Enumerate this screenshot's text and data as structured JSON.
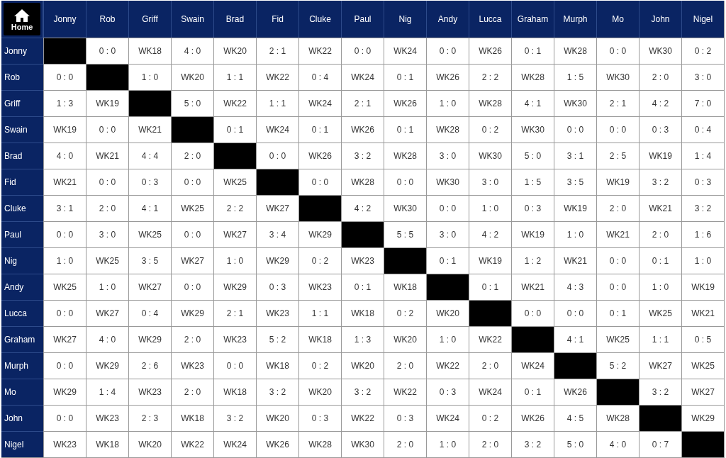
{
  "home_button": {
    "label": "Home"
  },
  "columns": [
    "Jonny",
    "Rob",
    "Griff",
    "Swain",
    "Brad",
    "Fid",
    "Cluke",
    "Paul",
    "Nig",
    "Andy",
    "Lucca",
    "Graham",
    "Murph",
    "Mo",
    "John",
    "Nigel"
  ],
  "rows": [
    {
      "name": "Jonny",
      "cells": [
        null,
        "0 : 0",
        "WK18",
        "4 : 0",
        "WK20",
        "2 : 1",
        "WK22",
        "0 : 0",
        "WK24",
        "0 : 0",
        "WK26",
        "0 : 1",
        "WK28",
        "0 : 0",
        "WK30",
        "0 : 2"
      ]
    },
    {
      "name": "Rob",
      "cells": [
        "0 : 0",
        null,
        "1 : 0",
        "WK20",
        "1 : 1",
        "WK22",
        "0 : 4",
        "WK24",
        "0 : 1",
        "WK26",
        "2 : 2",
        "WK28",
        "1 : 5",
        "WK30",
        "2 : 0",
        "3 : 0"
      ]
    },
    {
      "name": "Griff",
      "cells": [
        "1 : 3",
        "WK19",
        null,
        "5 : 0",
        "WK22",
        "1 : 1",
        "WK24",
        "2 : 1",
        "WK26",
        "1 : 0",
        "WK28",
        "4 : 1",
        "WK30",
        "2 : 1",
        "4 : 2",
        "7 : 0"
      ]
    },
    {
      "name": "Swain",
      "cells": [
        "WK19",
        "0 : 0",
        "WK21",
        null,
        "0 : 1",
        "WK24",
        "0 : 1",
        "WK26",
        "0 : 1",
        "WK28",
        "0 : 2",
        "WK30",
        "0 : 0",
        "0 : 0",
        "0 : 3",
        "0 : 4"
      ]
    },
    {
      "name": "Brad",
      "cells": [
        "4 : 0",
        "WK21",
        "4 : 4",
        "2 : 0",
        null,
        "0 : 0",
        "WK26",
        "3 : 2",
        "WK28",
        "3 : 0",
        "WK30",
        "5 : 0",
        "3 : 1",
        "2 : 5",
        "WK19",
        "1 : 4"
      ]
    },
    {
      "name": "Fid",
      "cells": [
        "WK21",
        "0 : 0",
        "0 : 3",
        "0 : 0",
        "WK25",
        null,
        "0 : 0",
        "WK28",
        "0 : 0",
        "WK30",
        "3 : 0",
        "1 : 5",
        "3 : 5",
        "WK19",
        "3 : 2",
        "0 : 3"
      ]
    },
    {
      "name": "Cluke",
      "cells": [
        "3 : 1",
        "2 : 0",
        "4 : 1",
        "WK25",
        "2 : 2",
        "WK27",
        null,
        "4 : 2",
        "WK30",
        "0 : 0",
        "1 : 0",
        "0 : 3",
        "WK19",
        "2 : 0",
        "WK21",
        "3 : 2"
      ]
    },
    {
      "name": "Paul",
      "cells": [
        "0 : 0",
        "3 : 0",
        "WK25",
        "0 : 0",
        "WK27",
        "3 : 4",
        "WK29",
        null,
        "5 : 5",
        "3 : 0",
        "4 : 2",
        "WK19",
        "1 : 0",
        "WK21",
        "2 : 0",
        "1 : 6"
      ]
    },
    {
      "name": "Nig",
      "cells": [
        "1 : 0",
        "WK25",
        "3 : 5",
        "WK27",
        "1 : 0",
        "WK29",
        "0 : 2",
        "WK23",
        null,
        "0 : 1",
        "WK19",
        "1 : 2",
        "WK21",
        "0 : 0",
        "0 : 1",
        "1 : 0"
      ]
    },
    {
      "name": "Andy",
      "cells": [
        "WK25",
        "1 : 0",
        "WK27",
        "0 : 0",
        "WK29",
        "0 : 3",
        "WK23",
        "0 : 1",
        "WK18",
        null,
        "0 : 1",
        "WK21",
        "4 : 3",
        "0 : 0",
        "1 : 0",
        "WK19"
      ]
    },
    {
      "name": "Lucca",
      "cells": [
        "0 : 0",
        "WK27",
        "0 : 4",
        "WK29",
        "2 : 1",
        "WK23",
        "1 : 1",
        "WK18",
        "0 : 2",
        "WK20",
        null,
        "0 : 0",
        "0 : 0",
        "0 : 1",
        "WK25",
        "WK21"
      ]
    },
    {
      "name": "Graham",
      "cells": [
        "WK27",
        "4 : 0",
        "WK29",
        "2 : 0",
        "WK23",
        "5 : 2",
        "WK18",
        "1 : 3",
        "WK20",
        "1 : 0",
        "WK22",
        null,
        "4 : 1",
        "WK25",
        "1 : 1",
        "0 : 5"
      ]
    },
    {
      "name": "Murph",
      "cells": [
        "0 : 0",
        "WK29",
        "2 : 6",
        "WK23",
        "0 : 0",
        "WK18",
        "0 : 2",
        "WK20",
        "2 : 0",
        "WK22",
        "2 : 0",
        "WK24",
        null,
        "5 : 2",
        "WK27",
        "WK25"
      ]
    },
    {
      "name": "Mo",
      "cells": [
        "WK29",
        "1 : 4",
        "WK23",
        "2 : 0",
        "WK18",
        "3 : 2",
        "WK20",
        "3 : 2",
        "WK22",
        "0 : 3",
        "WK24",
        "0 : 1",
        "WK26",
        null,
        "3 : 2",
        "WK27"
      ]
    },
    {
      "name": "John",
      "cells": [
        "0 : 0",
        "WK23",
        "2 : 3",
        "WK18",
        "3 : 2",
        "WK20",
        "0 : 3",
        "WK22",
        "0 : 3",
        "WK24",
        "0 : 2",
        "WK26",
        "4 : 5",
        "WK28",
        null,
        "WK29"
      ]
    },
    {
      "name": "Nigel",
      "cells": [
        "WK23",
        "WK18",
        "WK20",
        "WK22",
        "WK24",
        "WK26",
        "WK28",
        "WK30",
        "2 : 0",
        "1 : 0",
        "2 : 0",
        "3 : 2",
        "5 : 0",
        "4 : 0",
        "0 : 7",
        null
      ]
    }
  ]
}
